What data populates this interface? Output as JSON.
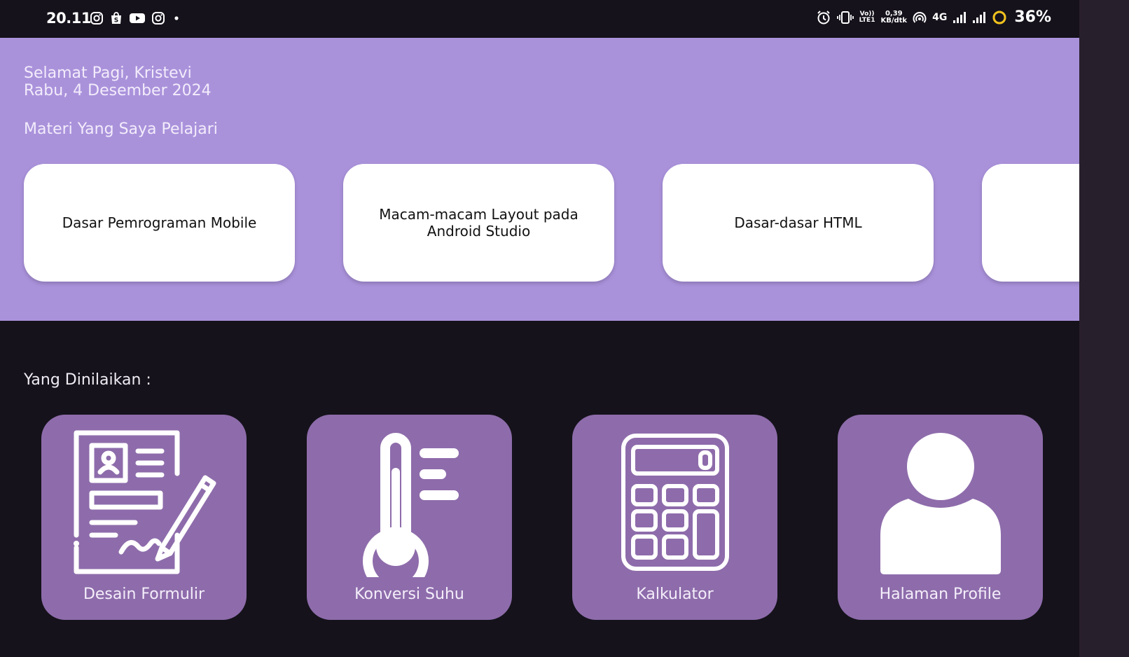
{
  "status_bar": {
    "time": "20.11",
    "volte_line1": "Vo))",
    "volte_line2": "LTE1",
    "net_speed_value": "0,39",
    "net_speed_unit": "KB/dtk",
    "network_type": "4G",
    "battery": "36%",
    "left_icons": [
      "instagram-icon",
      "shopee-icon",
      "youtube-icon",
      "instagram-icon",
      "dot-icon"
    ],
    "right_icons": [
      "alarm-icon",
      "vibrate-icon",
      "hotspot-icon",
      "signal-icon",
      "battery-ring-icon"
    ]
  },
  "header": {
    "greeting": "Selamat Pagi, Kristevi",
    "date": "Rabu, 4 Desember 2024",
    "materi_title": "Materi Yang Saya Pelajari"
  },
  "courses": [
    {
      "label": "Dasar Pemrograman Mobile"
    },
    {
      "label": "Macam-macam Layout pada Android Studio"
    },
    {
      "label": "Dasar-dasar HTML"
    },
    {
      "label": ""
    }
  ],
  "graded": {
    "title": "Yang Dinilaikan :",
    "items": [
      {
        "label": "Desain Formulir",
        "icon": "form-icon"
      },
      {
        "label": "Konversi Suhu",
        "icon": "thermometer-icon"
      },
      {
        "label": "Kalkulator",
        "icon": "calculator-icon"
      },
      {
        "label": "Halaman Profile",
        "icon": "user-icon"
      }
    ]
  },
  "colors": {
    "header_bg": "#aa92db",
    "tile_bg": "#8e6cab",
    "screen_bg": "#15121b",
    "battery_ring": "#f2c21b"
  }
}
